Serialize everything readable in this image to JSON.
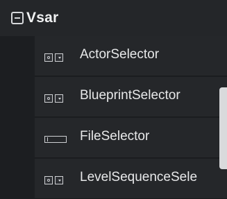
{
  "group": {
    "title": "Vsar",
    "toggle_icon": "minus-box-icon"
  },
  "items": [
    {
      "label": "ActorSelector",
      "icon": "selector-widget-icon"
    },
    {
      "label": "BlueprintSelector",
      "icon": "selector-widget-icon"
    },
    {
      "label": "FileSelector",
      "icon": "text-field-icon"
    },
    {
      "label": "LevelSequenceSele",
      "icon": "selector-widget-icon"
    }
  ],
  "colors": {
    "background": "#1c1e21",
    "item_background": "#25272a",
    "text": "#e8e9ea",
    "scrollbar": "#d9dadc"
  }
}
